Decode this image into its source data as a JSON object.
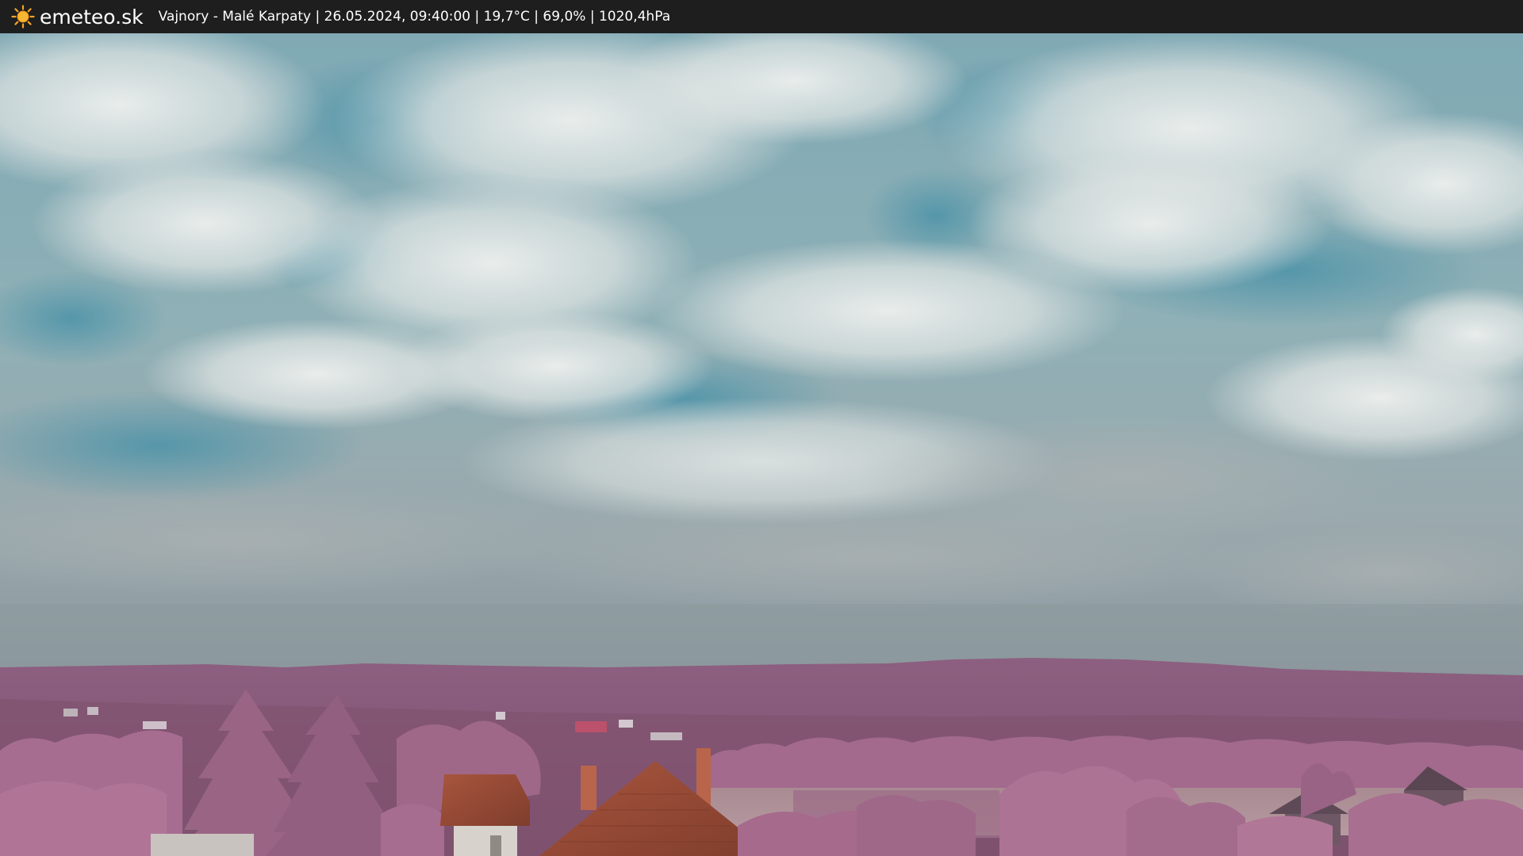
{
  "overlay": {
    "logo_text": "emeteo.sk",
    "caption": "Vajnory - Malé Karpaty | 26.05.2024, 09:40:00 | 19,7°C | 69,0% | 1020,4hPa"
  },
  "icons": {
    "logo": "sun-icon"
  },
  "colors": {
    "topbar": "#1e1e1e",
    "sun": "#f5a623",
    "sky_blue": "#5f9aaa",
    "cloud": "#e6e8e6",
    "hills": "#8a5a7c",
    "trees": "#a66a8e",
    "roof": "#b25a40"
  }
}
